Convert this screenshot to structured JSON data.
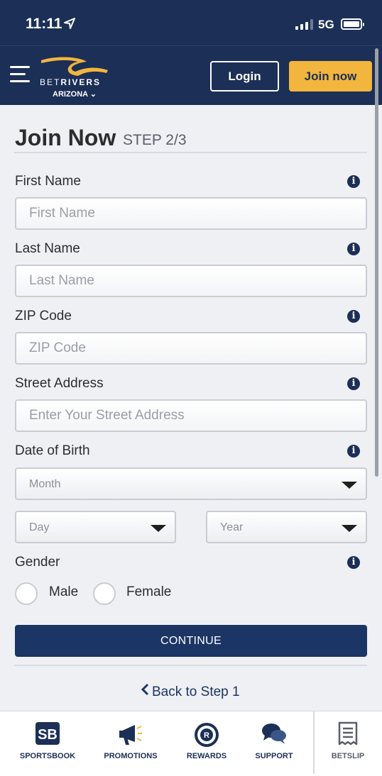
{
  "status_bar": {
    "time": "11:11",
    "network": "5G"
  },
  "header": {
    "brand_prefix": "BET",
    "brand_suffix": "RIVERS",
    "state": "ARIZONA",
    "login_label": "Login",
    "join_label": "Join now"
  },
  "form": {
    "title": "Join Now",
    "step": "STEP 2/3",
    "first_name": {
      "label": "First Name",
      "placeholder": "First Name"
    },
    "last_name": {
      "label": "Last Name",
      "placeholder": "Last Name"
    },
    "zip": {
      "label": "ZIP Code",
      "placeholder": "ZIP Code"
    },
    "street": {
      "label": "Street Address",
      "placeholder": "Enter Your Street Address"
    },
    "dob": {
      "label": "Date of Birth",
      "month": "Month",
      "day": "Day",
      "year": "Year"
    },
    "gender": {
      "label": "Gender",
      "male": "Male",
      "female": "Female"
    },
    "info_glyph": "i",
    "continue_label": "CONTINUE",
    "back_label": "Back to Step 1"
  },
  "tabbar": {
    "items": [
      {
        "label": "SPORTSBOOK",
        "icon": "sportsbook-icon"
      },
      {
        "label": "PROMOTIONS",
        "icon": "megaphone-icon"
      },
      {
        "label": "REWARDS",
        "icon": "rewards-badge-icon"
      },
      {
        "label": "SUPPORT",
        "icon": "chat-bubbles-icon"
      },
      {
        "label": "BETSLIP",
        "icon": "betslip-receipt-icon"
      }
    ]
  },
  "colors": {
    "navy": "#1b2f57",
    "accent": "#f2b53d",
    "button": "#1b3564"
  }
}
